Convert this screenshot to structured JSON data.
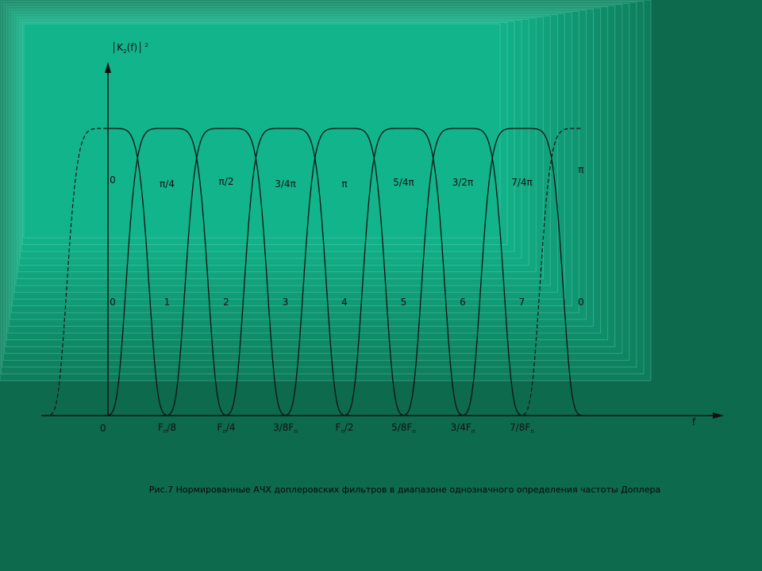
{
  "slide": {
    "caption": "Рис.7 Нормированные АЧХ доплеровских фильтров в диапазоне однозначного определения частоты Доплера",
    "colors": {
      "background": "#0d6a4c",
      "panel_inner": "#12b48b",
      "panel_outer": "#0e7d5c",
      "curves": "#111111"
    }
  },
  "chart_data": {
    "type": "line",
    "y_axis_label": {
      "main": "K",
      "sub": "2",
      "rest": "(f)",
      "power": "2"
    },
    "x_axis_label": "f",
    "origin_label": "0",
    "ylim": [
      0,
      1
    ],
    "x_unit": "Fп",
    "x_ticks": [
      {
        "value": 0.125,
        "main": "F",
        "sub": "п",
        "rest": "/8"
      },
      {
        "value": 0.25,
        "main": "F",
        "sub": "п",
        "rest": "/4"
      },
      {
        "value": 0.375,
        "main": "3/8F",
        "sub": "п",
        "rest": ""
      },
      {
        "value": 0.5,
        "main": "F",
        "sub": "п",
        "rest": "/2"
      },
      {
        "value": 0.625,
        "main": "5/8F",
        "sub": "п",
        "rest": ""
      },
      {
        "value": 0.75,
        "main": "3/4F",
        "sub": "п",
        "rest": ""
      },
      {
        "value": 0.875,
        "main": "7/8F",
        "sub": "п",
        "rest": ""
      }
    ],
    "filters": [
      {
        "index": "0",
        "phase": "0",
        "center": 0.0,
        "style": "solid",
        "mirror_dashed": true
      },
      {
        "index": "1",
        "phase": "π/4",
        "center": 0.125,
        "style": "solid"
      },
      {
        "index": "2",
        "phase": "π/2",
        "center": 0.25,
        "style": "solid"
      },
      {
        "index": "3",
        "phase": "3/4π",
        "center": 0.375,
        "style": "solid"
      },
      {
        "index": "4",
        "phase": "π",
        "center": 0.5,
        "style": "solid"
      },
      {
        "index": "5",
        "phase": "5/4π",
        "center": 0.625,
        "style": "solid"
      },
      {
        "index": "6",
        "phase": "3/2π",
        "center": 0.75,
        "style": "solid"
      },
      {
        "index": "7",
        "phase": "7/4π",
        "center": 0.875,
        "style": "solid"
      },
      {
        "index": "0",
        "phase": "π",
        "center": 1.0,
        "style": "dashed"
      }
    ]
  }
}
